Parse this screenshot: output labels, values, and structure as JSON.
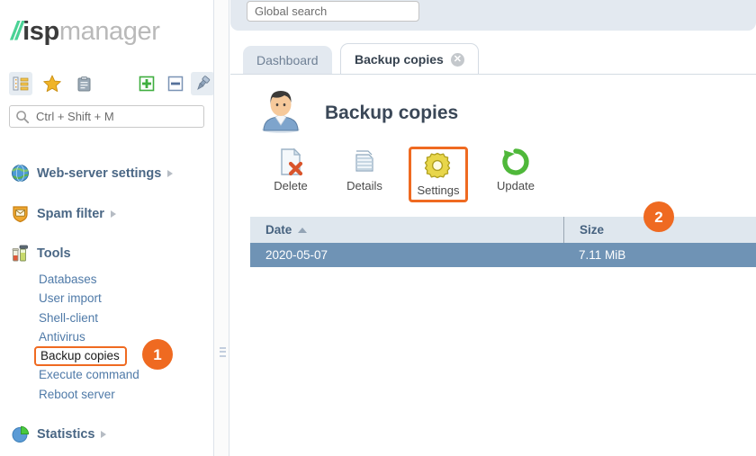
{
  "brand": {
    "slashes": "//",
    "name_bold": "isp",
    "name_light": "manager"
  },
  "sidebar": {
    "toolbar_icons": [
      {
        "name": "tree-view-icon",
        "label": "Tree view"
      },
      {
        "name": "favorites-star-icon",
        "label": "Favorites"
      },
      {
        "name": "clipboard-icon",
        "label": "Clipboard"
      },
      {
        "name": "expand-plus-icon",
        "label": "Expand all"
      },
      {
        "name": "collapse-minus-icon",
        "label": "Collapse all"
      },
      {
        "name": "pin-icon",
        "label": "Pin menu"
      }
    ],
    "search": {
      "placeholder": "Ctrl + Shift + M",
      "value": "",
      "icon": "search-icon"
    },
    "groups": [
      {
        "label": "Web-server settings",
        "icon": "globe-icon",
        "has_arrow": true
      },
      {
        "label": "Spam filter",
        "icon": "shield-mail-icon",
        "has_arrow": true
      },
      {
        "label": "Tools",
        "icon": "tools-icon",
        "has_arrow": false
      },
      {
        "label": "Statistics",
        "icon": "pie-chart-icon",
        "has_arrow": true
      }
    ],
    "tools_items": [
      {
        "label": "Databases",
        "highlighted": false
      },
      {
        "label": "User import",
        "highlighted": false
      },
      {
        "label": "Shell-client",
        "highlighted": false
      },
      {
        "label": "Antivirus",
        "highlighted": false
      },
      {
        "label": "Backup copies",
        "highlighted": true
      },
      {
        "label": "Execute command",
        "highlighted": false
      },
      {
        "label": "Reboot server",
        "highlighted": false
      }
    ]
  },
  "topbar": {
    "global_search": {
      "placeholder": "Global search",
      "value": ""
    }
  },
  "tabs": [
    {
      "label": "Dashboard",
      "active": false,
      "closable": false
    },
    {
      "label": "Backup copies",
      "active": true,
      "closable": true,
      "close_icon": "close-icon"
    }
  ],
  "page": {
    "title": "Backup copies",
    "avatar_icon": "user-avatar-icon"
  },
  "actions": [
    {
      "label": "Delete",
      "icon": "delete-page-icon",
      "highlighted": false
    },
    {
      "label": "Details",
      "icon": "details-stack-icon",
      "highlighted": false
    },
    {
      "label": "Settings",
      "icon": "gear-icon",
      "highlighted": true
    },
    {
      "label": "Update",
      "icon": "refresh-icon",
      "highlighted": false
    }
  ],
  "table": {
    "columns": [
      {
        "label": "Date",
        "sorted": true,
        "sort_dir": "asc"
      },
      {
        "label": "Size",
        "sorted": false
      }
    ],
    "rows": [
      {
        "date": "2020-05-07",
        "size": "7.11 MiB",
        "selected": true
      }
    ]
  },
  "badges": [
    {
      "id": "badge-1",
      "text": "1"
    },
    {
      "id": "badge-2",
      "text": "2"
    }
  ],
  "colors": {
    "accent_orange": "#ef6a21",
    "brand_green": "#4ad295",
    "row_selected": "#6f93b5",
    "table_header": "#dfe7ee",
    "link_blue": "#4f7aa8"
  }
}
